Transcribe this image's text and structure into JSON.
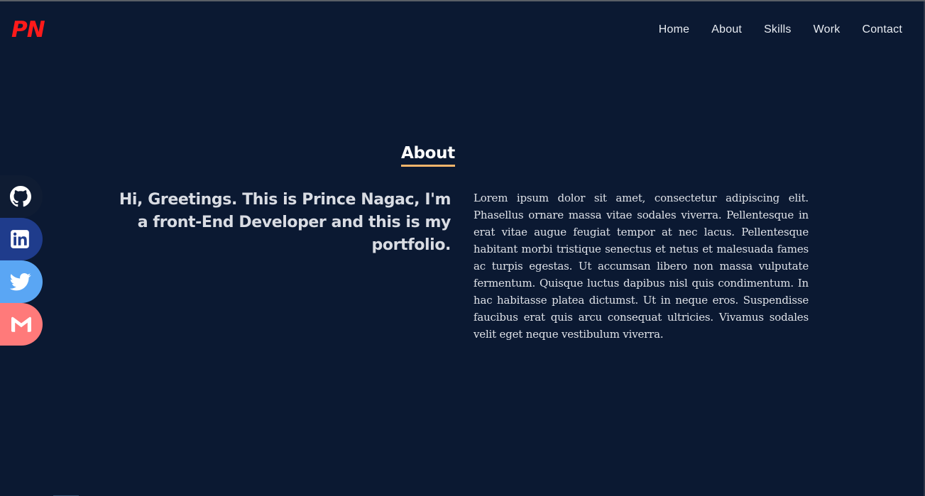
{
  "header": {
    "logo": "PN",
    "nav": [
      "Home",
      "About",
      "Skills",
      "Work",
      "Contact"
    ]
  },
  "about": {
    "title": "About",
    "greeting": "Hi, Greetings. This is Prince Nagac, I'm a front-End Developer and this is my portfolio.",
    "bio": "Lorem ipsum dolor sit amet, consectetur adipiscing elit. Phasellus ornare massa vitae sodales viverra. Pellentesque in erat vitae augue feugiat tempor at nec lacus. Pellentesque habitant morbi tristique senectus et netus et malesuada fames ac turpis egestas. Ut accumsan libero non massa vulputate fermentum. Quisque luctus dapibus nisl quis condimentum. In hac habitasse platea dictumst. Ut in neque eros. Suspendisse faucibus erat quis arcu consequat ultricies. Vivamus sodales velit eget neque vestibulum viverra."
  },
  "social": [
    {
      "icon": "github-icon",
      "color": "#0f1c33"
    },
    {
      "icon": "linkedin-icon",
      "color": "#1f3c8c"
    },
    {
      "icon": "twitter-icon",
      "color": "#5aa6f4"
    },
    {
      "icon": "gmail-icon",
      "color": "#ff7a7a"
    }
  ],
  "colors": {
    "background": "#0b1932",
    "logo": "#ff1a1a",
    "accent_underline": "#f6b56b"
  }
}
